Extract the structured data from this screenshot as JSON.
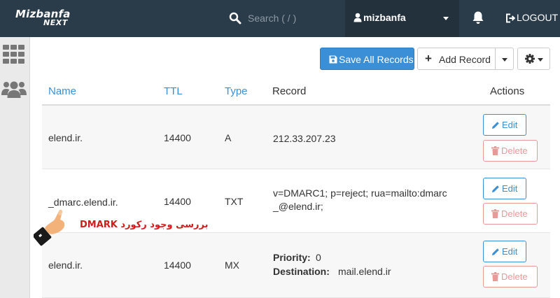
{
  "header": {
    "logo_line1": "Mizbanfa",
    "logo_line2": "NEXT",
    "search_placeholder": "Search ( / )",
    "username": "mizbanfa",
    "logout_label": "LOGOUT"
  },
  "sidebar": {
    "items": [
      {
        "icon": "grid-icon"
      },
      {
        "icon": "users-icon"
      }
    ]
  },
  "toolbar": {
    "save_label": "Save All Records",
    "add_label": "Add Record"
  },
  "table": {
    "columns": {
      "name": "Name",
      "ttl": "TTL",
      "type": "Type",
      "record": "Record",
      "actions": "Actions"
    },
    "edit_label": "Edit",
    "delete_label": "Delete",
    "rows": [
      {
        "name": "elend.ir.",
        "ttl": "14400",
        "type": "A",
        "record": "212.33.207.23"
      },
      {
        "name": "_dmarc.elend.ir.",
        "ttl": "14400",
        "type": "TXT",
        "record_line1": "v=DMARC1; p=reject; rua=mailto:dmarc",
        "record_line2": "_@elend.ir;"
      },
      {
        "name": "elend.ir.",
        "ttl": "14400",
        "type": "MX",
        "priority_label": "Priority:",
        "priority_value": "0",
        "destination_label": "Destination:",
        "destination_value": "mail.elend.ir"
      }
    ]
  },
  "annotation": {
    "text": "بررسی وجود رکورد DMARK",
    "color": "#d21b1b"
  },
  "colors": {
    "topbar": "#2a3b49",
    "primary": "#3b8fd6",
    "danger": "#e89a98"
  }
}
